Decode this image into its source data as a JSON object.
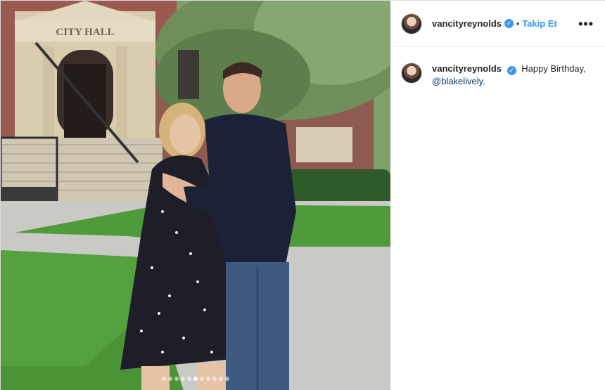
{
  "header": {
    "username": "vancityreynolds",
    "separator": "•",
    "follow_label": "Takip Et",
    "more_label": "•••"
  },
  "caption": {
    "username": "vancityreynolds",
    "text": "Happy Birthday,",
    "mention": "@blakelively."
  },
  "media": {
    "building_sign": "CITY HALL",
    "carousel": {
      "total": 11,
      "active": 5
    }
  },
  "icons": {
    "verified": "verified-badge-icon",
    "more": "more-options-icon"
  },
  "colors": {
    "accent": "#3897f0",
    "mention": "#003569",
    "text": "#262626"
  }
}
